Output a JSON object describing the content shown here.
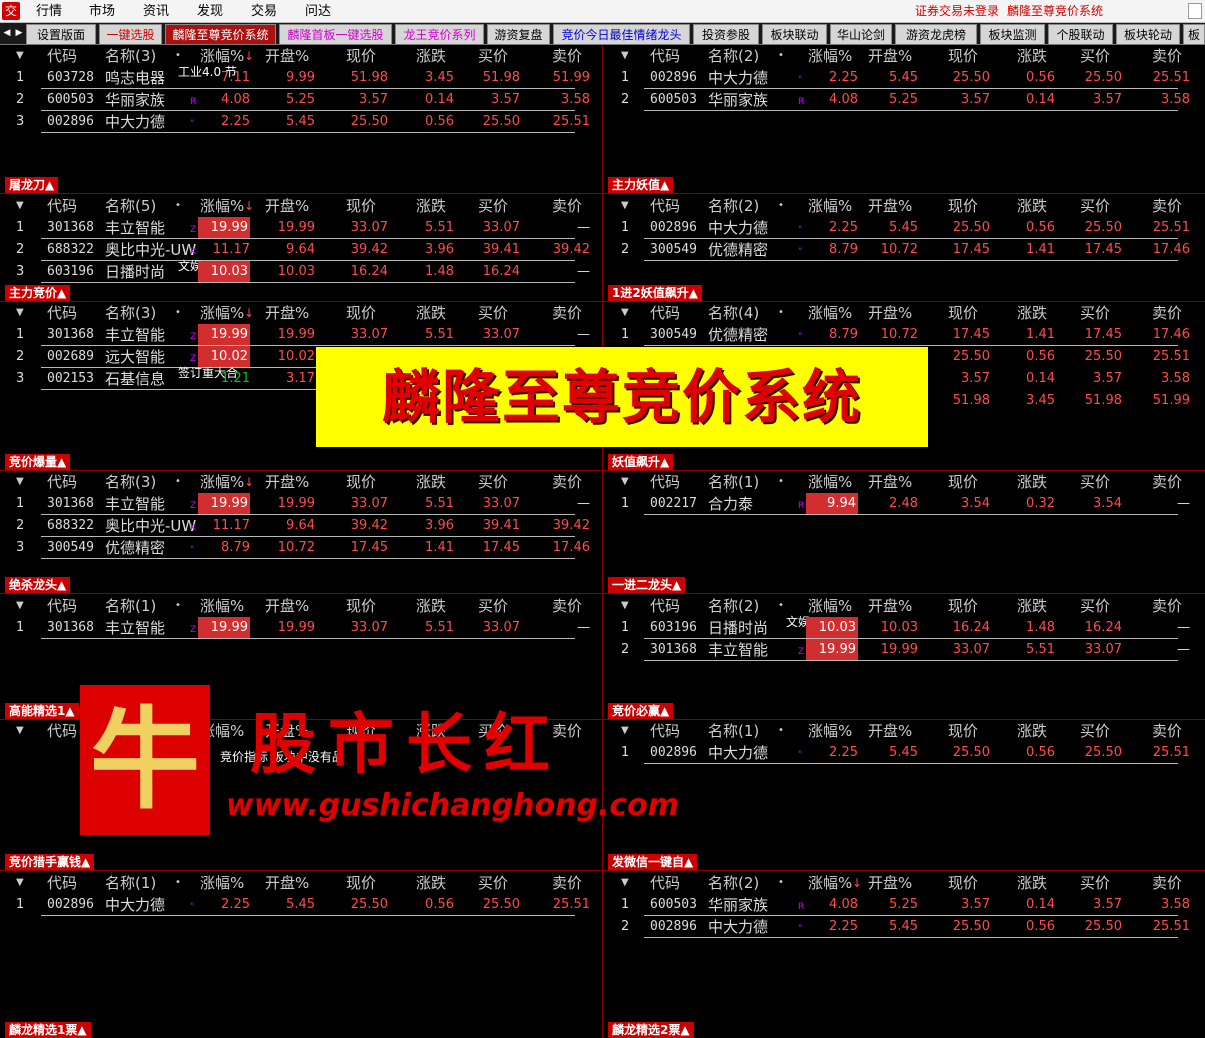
{
  "menu": {
    "logo": "交",
    "items": [
      "行情",
      "市场",
      "资讯",
      "发现",
      "交易",
      "问达"
    ],
    "login_status": "证券交易未登录",
    "window_title": "麟隆至尊竞价系统"
  },
  "tabs": [
    "设置版面",
    "一键选股",
    "麟隆至尊竞价系统",
    "麟隆首板一键选股",
    "龙王竞价系列",
    "游资复盘",
    "竞价今日最佳情绪龙头",
    "投资参股",
    "板块联动",
    "华山论剑",
    "游资龙虎榜",
    "板块监测",
    "个股联动",
    "板块轮动",
    "板"
  ],
  "tab_colors": [
    "#000000",
    "#d40000",
    "#ffffff",
    "#d400d4",
    "#d400d4",
    "#000000",
    "#0000d4",
    "#000000",
    "#000000",
    "#000000",
    "#000000",
    "#000000",
    "#000000",
    "#000000",
    "#000000"
  ],
  "columns": [
    "代码",
    "涨幅%",
    "开盘%",
    "现价",
    "涨跌",
    "买价",
    "卖价"
  ],
  "banner": "麟隆至尊竞价系统",
  "watermark": {
    "seal_char": "牛",
    "name": "股市长红",
    "url": "www.gushichanghong.com"
  },
  "panels": [
    {
      "title": "屠龙刀▲",
      "name_header": "名称(3)",
      "sort": "↓",
      "rows": [
        {
          "no": "1",
          "code": "603728",
          "name": "鸣志电器",
          "mark": "",
          "note": "工业4.0 节",
          "chg": "7.11",
          "open": "9.99",
          "price": "51.98",
          "diff": "3.45",
          "bid": "51.98",
          "ask": "51.99",
          "boxed": false
        },
        {
          "no": "2",
          "code": "600503",
          "name": "华丽家族",
          "mark": "R",
          "note": "",
          "chg": "4.08",
          "open": "5.25",
          "price": "3.57",
          "diff": "0.14",
          "bid": "3.57",
          "ask": "3.58",
          "boxed": false
        },
        {
          "no": "3",
          "code": "002896",
          "name": "中大力德",
          "mark": "\"",
          "note": "",
          "chg": "2.25",
          "open": "5.45",
          "price": "25.50",
          "diff": "0.56",
          "bid": "25.50",
          "ask": "25.51",
          "boxed": false
        }
      ]
    },
    {
      "title": "主力妖值▲",
      "name_header": "名称(2)",
      "sort": "",
      "rows": [
        {
          "no": "1",
          "code": "002896",
          "name": "中大力德",
          "mark": "\"",
          "note": "",
          "chg": "2.25",
          "open": "5.45",
          "price": "25.50",
          "diff": "0.56",
          "bid": "25.50",
          "ask": "25.51",
          "boxed": false
        },
        {
          "no": "2",
          "code": "600503",
          "name": "华丽家族",
          "mark": "R",
          "note": "",
          "chg": "4.08",
          "open": "5.25",
          "price": "3.57",
          "diff": "0.14",
          "bid": "3.57",
          "ask": "3.58",
          "boxed": false
        }
      ]
    },
    {
      "title": "主力竞价▲",
      "name_header": "名称(5)",
      "sort": "↓",
      "rows": [
        {
          "no": "1",
          "code": "301368",
          "name": "丰立智能",
          "mark": "Z",
          "note": "",
          "chg": "19.99",
          "open": "19.99",
          "price": "33.07",
          "diff": "5.51",
          "bid": "33.07",
          "ask": "—",
          "boxed": true
        },
        {
          "no": "2",
          "code": "688322",
          "name": "奥比中光-UW",
          "mark": "K",
          "note": "",
          "chg": "11.17",
          "open": "9.64",
          "price": "39.42",
          "diff": "3.96",
          "bid": "39.41",
          "ask": "39.42",
          "boxed": false
        },
        {
          "no": "3",
          "code": "603196",
          "name": "日播时尚",
          "mark": "",
          "note": "文娱",
          "chg": "10.03",
          "open": "10.03",
          "price": "16.24",
          "diff": "1.48",
          "bid": "16.24",
          "ask": "—",
          "boxed": true
        }
      ]
    },
    {
      "title": "1进2妖值飙升▲",
      "name_header": "名称(2)",
      "sort": "",
      "rows": [
        {
          "no": "1",
          "code": "002896",
          "name": "中大力德",
          "mark": "\"",
          "note": "",
          "chg": "2.25",
          "open": "5.45",
          "price": "25.50",
          "diff": "0.56",
          "bid": "25.50",
          "ask": "25.51",
          "boxed": false
        },
        {
          "no": "2",
          "code": "300549",
          "name": "优德精密",
          "mark": "\"",
          "note": "",
          "chg": "8.79",
          "open": "10.72",
          "price": "17.45",
          "diff": "1.41",
          "bid": "17.45",
          "ask": "17.46",
          "boxed": false
        }
      ]
    },
    {
      "title": "竞价爆量▲",
      "name_header": "名称(3)",
      "sort": "↓",
      "rows": [
        {
          "no": "1",
          "code": "301368",
          "name": "丰立智能",
          "mark": "Z",
          "note": "",
          "chg": "19.99",
          "open": "19.99",
          "price": "33.07",
          "diff": "5.51",
          "bid": "33.07",
          "ask": "—",
          "boxed": true
        },
        {
          "no": "2",
          "code": "002689",
          "name": "远大智能",
          "mark": "Z",
          "note": "",
          "chg": "10.02",
          "open": "10.02",
          "price": "",
          "diff": "",
          "bid": "",
          "ask": "",
          "boxed": true
        },
        {
          "no": "3",
          "code": "002153",
          "name": "石基信息",
          "mark": "",
          "note": "签订重大合",
          "chg": "1.21",
          "open": "3.17",
          "price": "",
          "diff": "",
          "bid": "",
          "ask": "",
          "boxed": false,
          "chg_green": true
        }
      ]
    },
    {
      "title": "妖值飙升▲",
      "name_header": "名称(4)",
      "sort": "",
      "rows": [
        {
          "no": "1",
          "code": "300549",
          "name": "优德精密",
          "mark": "\"",
          "note": "",
          "chg": "8.79",
          "open": "10.72",
          "price": "17.45",
          "diff": "1.41",
          "bid": "17.45",
          "ask": "17.46",
          "boxed": false
        },
        {
          "no": "",
          "code": "",
          "name": "",
          "mark": "",
          "note": "",
          "chg": "",
          "open": "",
          "price": "25.50",
          "diff": "0.56",
          "bid": "25.50",
          "ask": "25.51",
          "boxed": false
        },
        {
          "no": "",
          "code": "",
          "name": "",
          "mark": "",
          "note": "",
          "chg": "",
          "open": "",
          "price": "3.57",
          "diff": "0.14",
          "bid": "3.57",
          "ask": "3.58",
          "boxed": false
        },
        {
          "no": "",
          "code": "",
          "name": "",
          "mark": "",
          "note": "",
          "chg": "",
          "open": "",
          "price": "51.98",
          "diff": "3.45",
          "bid": "51.98",
          "ask": "51.99",
          "boxed": false
        }
      ]
    },
    {
      "title": "绝杀龙头▲",
      "name_header": "名称(3)",
      "sort": "↓",
      "rows": [
        {
          "no": "1",
          "code": "301368",
          "name": "丰立智能",
          "mark": "Z",
          "note": "",
          "chg": "19.99",
          "open": "19.99",
          "price": "33.07",
          "diff": "5.51",
          "bid": "33.07",
          "ask": "—",
          "boxed": true
        },
        {
          "no": "2",
          "code": "688322",
          "name": "奥比中光-UW",
          "mark": "K",
          "note": "",
          "chg": "11.17",
          "open": "9.64",
          "price": "39.42",
          "diff": "3.96",
          "bid": "39.41",
          "ask": "39.42",
          "boxed": false
        },
        {
          "no": "3",
          "code": "300549",
          "name": "优德精密",
          "mark": "\"",
          "note": "",
          "chg": "8.79",
          "open": "10.72",
          "price": "17.45",
          "diff": "1.41",
          "bid": "17.45",
          "ask": "17.46",
          "boxed": false
        }
      ]
    },
    {
      "title": "一进二龙头▲",
      "name_header": "名称(1)",
      "sort": "",
      "rows": [
        {
          "no": "1",
          "code": "002217",
          "name": "合力泰",
          "mark": "R",
          "note": "",
          "chg": "9.94",
          "open": "2.48",
          "price": "3.54",
          "diff": "0.32",
          "bid": "3.54",
          "ask": "—",
          "boxed": true
        }
      ]
    },
    {
      "title": "高能精选1▲",
      "name_header": "名称(1)",
      "sort": "",
      "rows": [
        {
          "no": "1",
          "code": "301368",
          "name": "丰立智能",
          "mark": "Z",
          "note": "",
          "chg": "19.99",
          "open": "19.99",
          "price": "33.07",
          "diff": "5.51",
          "bid": "33.07",
          "ask": "—",
          "boxed": true
        }
      ]
    },
    {
      "title": "竞价必赢▲",
      "name_header": "名称(2)",
      "sort": "",
      "rows": [
        {
          "no": "1",
          "code": "603196",
          "name": "日播时尚",
          "mark": "",
          "note": "文娱",
          "chg": "10.03",
          "open": "10.03",
          "price": "16.24",
          "diff": "1.48",
          "bid": "16.24",
          "ask": "—",
          "boxed": true
        },
        {
          "no": "2",
          "code": "301368",
          "name": "丰立智能",
          "mark": "Z",
          "note": "",
          "chg": "19.99",
          "open": "19.99",
          "price": "33.07",
          "diff": "5.51",
          "bid": "33.07",
          "ask": "—",
          "boxed": true
        }
      ]
    },
    {
      "title": "竞价猎手赢钱▲",
      "name_header": "",
      "sort": "",
      "empty_msg": "竞价指标  板块中没有品",
      "rows": []
    },
    {
      "title": "发微信一键自▲",
      "name_header": "名称(1)",
      "sort": "",
      "rows": [
        {
          "no": "1",
          "code": "002896",
          "name": "中大力德",
          "mark": "\"",
          "note": "",
          "chg": "2.25",
          "open": "5.45",
          "price": "25.50",
          "diff": "0.56",
          "bid": "25.50",
          "ask": "25.51",
          "boxed": false
        }
      ]
    },
    {
      "title": "麟龙精选1票▲",
      "name_header": "名称(1)",
      "sort": "",
      "rows": [
        {
          "no": "1",
          "code": "002896",
          "name": "中大力德",
          "mark": "\"",
          "note": "",
          "chg": "2.25",
          "open": "5.45",
          "price": "25.50",
          "diff": "0.56",
          "bid": "25.50",
          "ask": "25.51",
          "boxed": false
        }
      ]
    },
    {
      "title": "麟龙精选2票▲",
      "name_header": "名称(2)",
      "sort": "↓",
      "rows": [
        {
          "no": "1",
          "code": "600503",
          "name": "华丽家族",
          "mark": "R",
          "note": "",
          "chg": "4.08",
          "open": "5.25",
          "price": "3.57",
          "diff": "0.14",
          "bid": "3.57",
          "ask": "3.58",
          "boxed": false
        },
        {
          "no": "2",
          "code": "002896",
          "name": "中大力德",
          "mark": "\"",
          "note": "",
          "chg": "2.25",
          "open": "5.45",
          "price": "25.50",
          "diff": "0.56",
          "bid": "25.50",
          "ask": "25.51",
          "boxed": false
        }
      ]
    }
  ]
}
